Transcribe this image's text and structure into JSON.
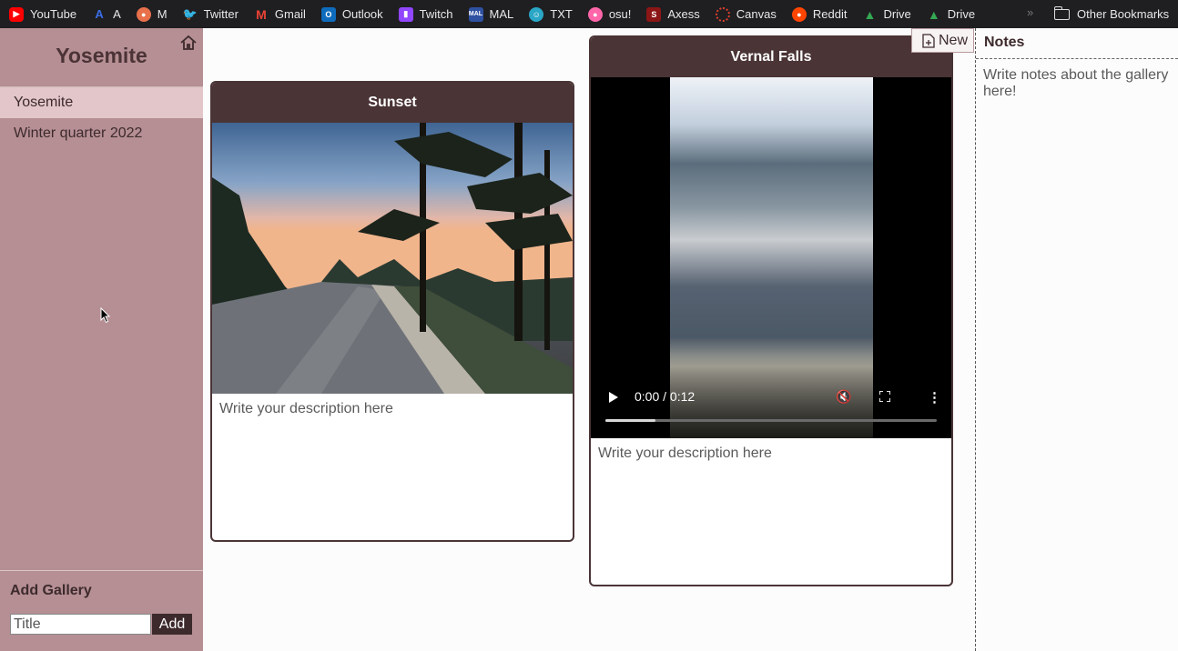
{
  "bookmarks": [
    {
      "label": "YouTube",
      "icon": "youtube-icon",
      "color": "#ff0000"
    },
    {
      "label": "A",
      "icon": "a-icon",
      "color": "#3b6ee8"
    },
    {
      "label": "M",
      "icon": "m-icon",
      "color": "#e8704a"
    },
    {
      "label": "Twitter",
      "icon": "twitter-icon",
      "color": "#1da1f2"
    },
    {
      "label": "Gmail",
      "icon": "gmail-icon",
      "color": "#ea4335"
    },
    {
      "label": "Outlook",
      "icon": "outlook-icon",
      "color": "#0f6cbd"
    },
    {
      "label": "Twitch",
      "icon": "twitch-icon",
      "color": "#9146ff"
    },
    {
      "label": "MAL",
      "icon": "mal-icon",
      "color": "#2e51a2"
    },
    {
      "label": "TXT",
      "icon": "txt-icon",
      "color": "#2aa6c6"
    },
    {
      "label": "osu!",
      "icon": "osu-icon",
      "color": "#ff66aa"
    },
    {
      "label": "Axess",
      "icon": "axess-icon",
      "color": "#8c1515"
    },
    {
      "label": "Canvas",
      "icon": "canvas-icon",
      "color": "#e13f2b"
    },
    {
      "label": "Reddit",
      "icon": "reddit-icon",
      "color": "#ff4500"
    },
    {
      "label": "Drive",
      "icon": "drive-icon",
      "color": "#34a853"
    },
    {
      "label": "Drive",
      "icon": "drive-icon",
      "color": "#34a853"
    }
  ],
  "bookmarks_more": "»",
  "other_bookmarks": "Other Bookmarks",
  "sidebar": {
    "title": "Yosemite",
    "galleries": [
      "Yosemite",
      "Winter quarter 2022"
    ],
    "active_gallery": "Yosemite",
    "add_heading": "Add Gallery",
    "title_placeholder": "Title",
    "add_label": "Add"
  },
  "cards": [
    {
      "title": "Sunset",
      "description_placeholder": "Write your description here"
    },
    {
      "title": "Vernal Falls",
      "description_placeholder": "Write your description here",
      "video": {
        "time": "0:00 / 0:12",
        "progress": 0.15
      }
    }
  ],
  "new_button": "New",
  "notes": {
    "title": "Notes",
    "placeholder": "Write notes about the gallery here!"
  },
  "colors": {
    "sidebar": "#b58f93",
    "accent": "#4a3436",
    "active_item": "#e2c6c9"
  }
}
